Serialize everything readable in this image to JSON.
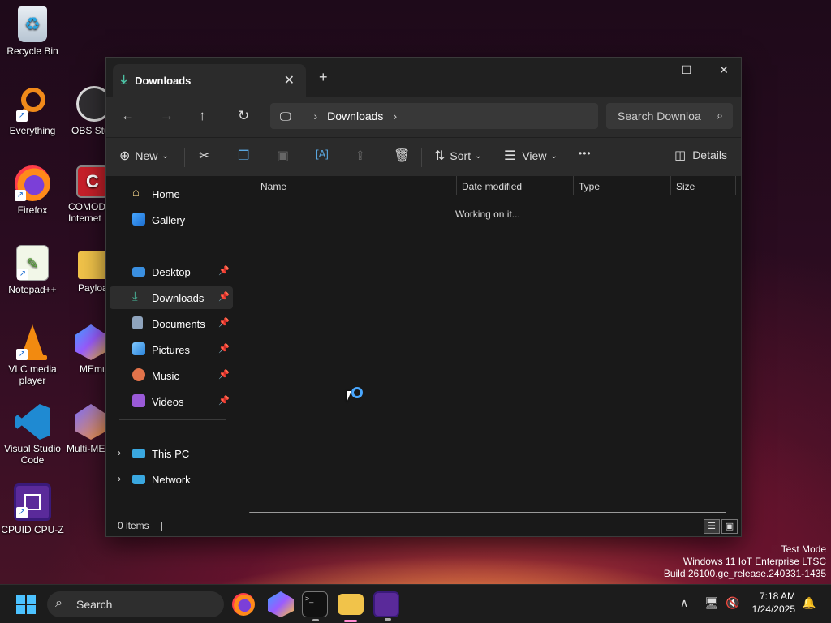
{
  "desktop": {
    "icons": [
      {
        "label": "Recycle Bin"
      },
      {
        "label": "Everything"
      },
      {
        "label": "OBS Stu"
      },
      {
        "label": "Firefox"
      },
      {
        "label": "COMOD Internet"
      },
      {
        "label": "Notepad++"
      },
      {
        "label": "Payloa"
      },
      {
        "label": "VLC media player"
      },
      {
        "label": "MEmu"
      },
      {
        "label": "Visual Studio Code"
      },
      {
        "label": "Multi-ME"
      },
      {
        "label": "CPUID CPU-Z"
      }
    ]
  },
  "window": {
    "tab_title": "Downloads",
    "new_tab": "+",
    "controls": {
      "minimize": "—",
      "maximize": "☐",
      "close": "✕"
    },
    "address": {
      "location": "Downloads"
    },
    "search": {
      "placeholder": "Search Downloa"
    },
    "toolbar": {
      "new_label": "New",
      "sort_label": "Sort",
      "view_label": "View",
      "more_label": "•••",
      "details_label": "Details"
    },
    "sidebar": {
      "home": "Home",
      "gallery": "Gallery",
      "pinned": [
        {
          "label": "Desktop"
        },
        {
          "label": "Downloads"
        },
        {
          "label": "Documents"
        },
        {
          "label": "Pictures"
        },
        {
          "label": "Music"
        },
        {
          "label": "Videos"
        }
      ],
      "this_pc": "This PC",
      "network": "Network"
    },
    "columns": [
      "Name",
      "Date modified",
      "Type",
      "Size"
    ],
    "working_text": "Working on it...",
    "status": {
      "items": "0 items"
    }
  },
  "watermark": {
    "line1": "Test Mode",
    "line2": "Windows 11 IoT Enterprise LTSC",
    "line3": "Build 26100.ge_release.240331-1435"
  },
  "taskbar": {
    "search_label": "Search",
    "time": "7:18 AM",
    "date": "1/24/2025"
  },
  "colors": {
    "accent": "#4cc2a4",
    "window_bg": "#191919",
    "toolbar_bg": "#2b2b2b"
  }
}
